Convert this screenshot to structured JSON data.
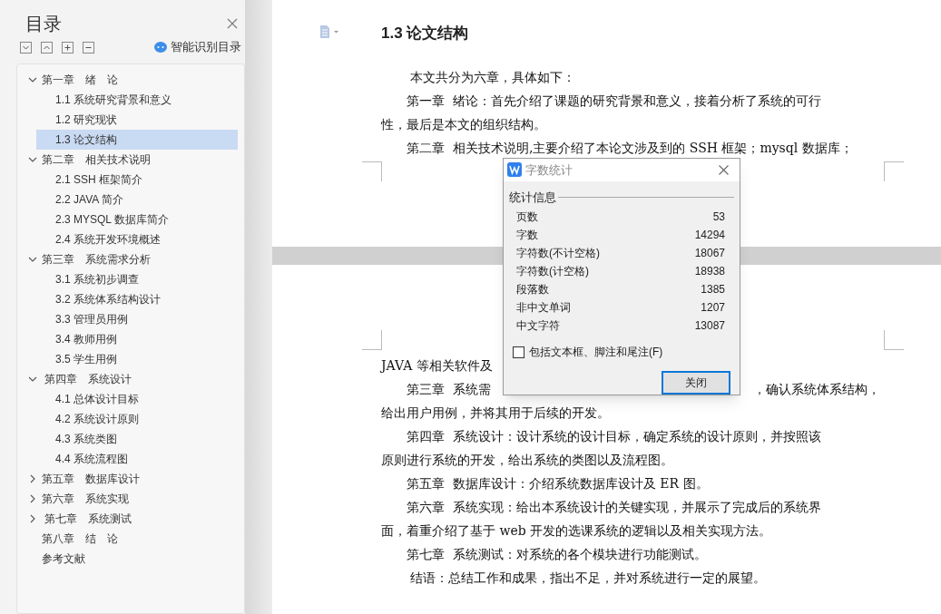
{
  "sidebar": {
    "title": "目录",
    "smart_toc": "智能识别目录",
    "items": [
      {
        "kind": "group",
        "label": "第一章　绪　论",
        "expanded": true,
        "children": [
          {
            "label": "1.1 系统研究背景和意义",
            "selected": false
          },
          {
            "label": "1.2 研究现状",
            "selected": false
          },
          {
            "label": "1.3 论文结构",
            "selected": true
          }
        ]
      },
      {
        "kind": "group",
        "label": "第二章　相关技术说明",
        "expanded": true,
        "children": [
          {
            "label": "2.1 SSH 框架简介",
            "selected": false
          },
          {
            "label": "2.2 JAVA 简介",
            "selected": false
          },
          {
            "label": "2.3 MYSQL 数据库简介",
            "selected": false
          },
          {
            "label": "2.4 系统开发环境概述",
            "selected": false
          }
        ]
      },
      {
        "kind": "group",
        "label": "第三章　系统需求分析",
        "expanded": true,
        "children": [
          {
            "label": "3.1 系统初步调查",
            "selected": false
          },
          {
            "label": "3.2 系统体系结构设计",
            "selected": false
          },
          {
            "label": "3.3 管理员用例",
            "selected": false
          },
          {
            "label": "3.4 教师用例",
            "selected": false
          },
          {
            "label": "3.5 学生用例",
            "selected": false
          }
        ]
      },
      {
        "kind": "group",
        "label": " 第四章　系统设计",
        "expanded": true,
        "children": [
          {
            "label": "4.1 总体设计目标",
            "selected": false
          },
          {
            "label": "4.2 系统设计原则",
            "selected": false
          },
          {
            "label": "4.3 系统类图",
            "selected": false
          },
          {
            "label": "4.4 系统流程图",
            "selected": false
          }
        ]
      },
      {
        "kind": "group",
        "label": "第五章　数据库设计",
        "expanded": false
      },
      {
        "kind": "group",
        "label": "第六章　系统实现",
        "expanded": false
      },
      {
        "kind": "group",
        "label": " 第七章　系统测试",
        "expanded": false
      },
      {
        "kind": "leaf",
        "label": "第八章　结　论"
      },
      {
        "kind": "leaf",
        "label": "参考文献"
      }
    ]
  },
  "document": {
    "heading": "1.3 论文结构",
    "page1_lines": [
      {
        "indent": true,
        "text": " 本文共分为六章，具体如下："
      },
      {
        "indent": true,
        "text": "第一章  绪论：首先介绍了课题的研究背景和意义，接着分析了系统的可行"
      },
      {
        "indent": false,
        "text": "性，最后是本文的组织结构。"
      },
      {
        "indent": true,
        "text": "第二章  相关技术说明,主要介绍了本论文涉及到的 SSH 框架；mysql 数据库；"
      }
    ],
    "page2_lines": [
      {
        "indent": false,
        "text": "JAVA 等相关软件及"
      },
      {
        "indent": true,
        "text": "第三章  系统需",
        "after": "，确认系统体系结构，"
      },
      {
        "indent": false,
        "text": "给出用户用例，并将其用于后续的开发。"
      },
      {
        "indent": true,
        "text": "第四章  系统设计：设计系统的设计目标，确定系统的设计原则，并按照该"
      },
      {
        "indent": false,
        "text": "原则进行系统的开发，给出系统的类图以及流程图。"
      },
      {
        "indent": true,
        "text": "第五章  数据库设计：介绍系统数据库设计及 ER 图。"
      },
      {
        "indent": true,
        "text": "第六章  系统实现：给出本系统设计的关键实现，并展示了完成后的系统界"
      },
      {
        "indent": false,
        "text": "面，着重介绍了基于 web 开发的选课系统的逻辑以及相关实现方法。"
      },
      {
        "indent": true,
        "text": "第七章  系统测试：对系统的各个模块进行功能测试。"
      },
      {
        "indent": true,
        "text": " 结语：总结工作和成果，指出不足，并对系统进行一定的展望。"
      }
    ]
  },
  "dialog": {
    "title": "字数统计",
    "section": "统计信息",
    "stats": [
      {
        "label": "页数",
        "value": "53"
      },
      {
        "label": "字数",
        "value": "14294"
      },
      {
        "label": "字符数(不计空格)",
        "value": "18067"
      },
      {
        "label": "字符数(计空格)",
        "value": "18938"
      },
      {
        "label": "段落数",
        "value": "1385"
      },
      {
        "label": "非中文单词",
        "value": "1207"
      },
      {
        "label": "中文字符",
        "value": "13087"
      }
    ],
    "include_checkbox": {
      "label": "包括文本框、脚注和尾注(F)",
      "checked": false
    },
    "close_button": "关闭"
  }
}
